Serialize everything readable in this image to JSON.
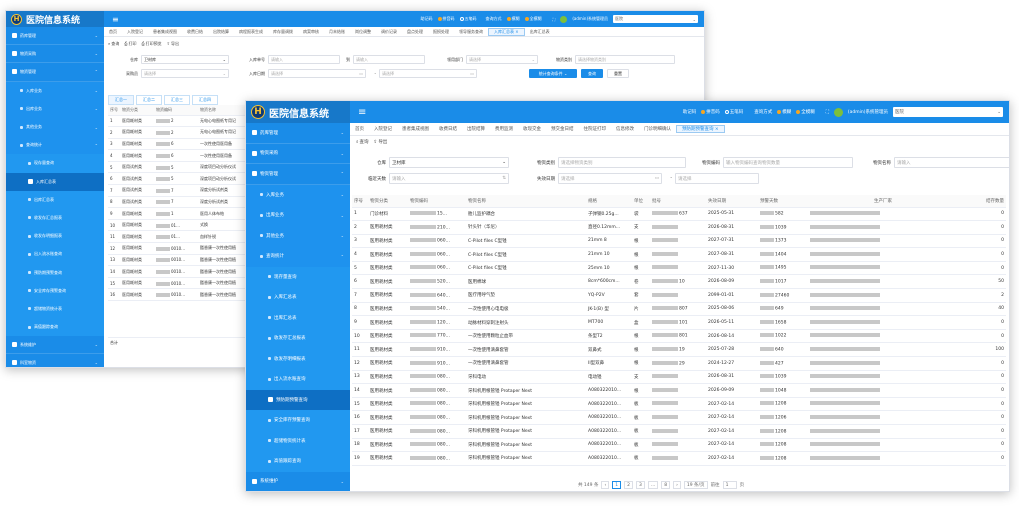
{
  "app_title": "医院信息系统",
  "logo_badge": "H",
  "topbar": {
    "mnemonic_label": "助记码",
    "pinyin": "拼音码",
    "wubi": "五笔码",
    "query_mode_label": "查询方式",
    "fuzzy": "模糊",
    "exact": "全模糊",
    "user": "(admin)系统管理员",
    "hospital_back": "医院",
    "hospital_front": "医院"
  },
  "back": {
    "sidebar": [
      {
        "label": "药库管理",
        "chev": "⌄",
        "kind": "top"
      },
      {
        "label": "物资采购",
        "chev": "⌄",
        "kind": "top"
      },
      {
        "label": "物资管理",
        "chev": "⌃",
        "kind": "top"
      },
      {
        "label": "入库业务",
        "chev": "⌄",
        "kind": "sub"
      },
      {
        "label": "出库业务",
        "chev": "⌄",
        "kind": "sub"
      },
      {
        "label": "其他业务",
        "chev": "⌄",
        "kind": "sub"
      },
      {
        "label": "查询统计",
        "chev": "⌃",
        "kind": "sub"
      },
      {
        "label": "现存量查询",
        "chev": "",
        "kind": "sub2"
      },
      {
        "label": "入库汇总表",
        "chev": "",
        "kind": "act"
      },
      {
        "label": "出库汇总表",
        "chev": "",
        "kind": "sub2"
      },
      {
        "label": "收发存汇总报表",
        "chev": "",
        "kind": "sub2"
      },
      {
        "label": "收发存明细报表",
        "chev": "",
        "kind": "sub2"
      },
      {
        "label": "出入流水账查询",
        "chev": "",
        "kind": "sub2"
      },
      {
        "label": "预防期预警查询",
        "chev": "",
        "kind": "sub2"
      },
      {
        "label": "安全库存预警查询",
        "chev": "",
        "kind": "sub2"
      },
      {
        "label": "超储物资统计表",
        "chev": "",
        "kind": "sub2"
      },
      {
        "label": "高值跟踪查询",
        "chev": "",
        "kind": "sub2"
      },
      {
        "label": "系统维护",
        "chev": "⌄",
        "kind": "top"
      },
      {
        "label": "科室物资",
        "chev": "⌄",
        "kind": "top"
      }
    ],
    "tabs": [
      "首页",
      "入院登记",
      "患者集成视图",
      "收费日结",
      "出院结算",
      "病程报表生成",
      "库存量调拨",
      "病案审核",
      "月末结账",
      "岗位调整",
      "调价记录",
      "盘点处理",
      "报损处理",
      "领导服务查询",
      "入库汇总表 ×",
      "出库汇总表"
    ],
    "toolbar": [
      "查询",
      "打印",
      "打印预览",
      "导出"
    ],
    "form": {
      "warehouse_label": "仓库",
      "warehouse_value": "卫材库",
      "entry_no_label": "入库单号",
      "entry_no_ph": "请输入",
      "to_label": "到",
      "to_ph": "请输入",
      "dept_label": "领用部门",
      "dept_ph": "请选择",
      "category_label": "物资类别",
      "category_ph": "请选择物资类别",
      "buyer_label": "采购员",
      "buyer_ph": "请选择",
      "date_label": "入库日期",
      "date_ph": "请选择",
      "date_end_ph": "请选择",
      "btn_stat": "统计查询条件 ⌄",
      "btn_query": "查询",
      "btn_reset": "重置"
    },
    "subtabs": [
      "汇总一",
      "汇总二",
      "汇总三",
      "汇总四"
    ],
    "columns": [
      "序号",
      "物资分类",
      "物资编码",
      "物资名称"
    ],
    "rows": [
      [
        "1",
        "医用耗材类",
        "2",
        "无电心电图纸专用记"
      ],
      [
        "2",
        "医用耗材类",
        "2",
        "无电心电图纸专用记"
      ],
      [
        "3",
        "医用耗材类",
        "6",
        "一次性使用医用备"
      ],
      [
        "4",
        "医用耗材类",
        "6",
        "一次性使用医用备"
      ],
      [
        "5",
        "医用试剂类",
        "5",
        "深度项目动分析仪试"
      ],
      [
        "6",
        "医用试剂类",
        "5",
        "深度项目动分析仪试"
      ],
      [
        "7",
        "医用试剂类",
        "7",
        "深度分析试剂类"
      ],
      [
        "8",
        "医用试剂类",
        "7",
        "深度分析试剂类"
      ],
      [
        "9",
        "医用耗材类",
        "1",
        "医用人体布帕"
      ],
      [
        "10",
        "医用耗材类",
        "01...",
        "式换"
      ],
      [
        "11",
        "医用耗材类",
        "01...",
        "血样针锐"
      ],
      [
        "12",
        "医用耗材类",
        "0010...",
        "酯香康一次性使用植"
      ],
      [
        "13",
        "医用耗材类",
        "0010...",
        "酯香康一次性使用植"
      ],
      [
        "14",
        "医用耗材类",
        "0010...",
        "酯香康一次性使用植"
      ],
      [
        "15",
        "医用耗材类",
        "0010...",
        "酯香康一次性使用植"
      ],
      [
        "16",
        "医用耗材类",
        "0010...",
        "酯香康一次性使用植"
      ]
    ],
    "total_label": "合计"
  },
  "front": {
    "sidebar": [
      {
        "label": "药库管理",
        "chev": "⌄",
        "kind": "top"
      },
      {
        "label": "物资采购",
        "chev": "⌄",
        "kind": "top"
      },
      {
        "label": "物资管理",
        "chev": "⌃",
        "kind": "top"
      },
      {
        "label": "入库业务",
        "chev": "⌄",
        "kind": "sub"
      },
      {
        "label": "出库业务",
        "chev": "⌄",
        "kind": "sub"
      },
      {
        "label": "其他业务",
        "chev": "⌄",
        "kind": "sub"
      },
      {
        "label": "查询统计",
        "chev": "⌃",
        "kind": "sub"
      },
      {
        "label": "现存量查询",
        "chev": "",
        "kind": "sub2"
      },
      {
        "label": "入库汇总表",
        "chev": "",
        "kind": "sub2"
      },
      {
        "label": "出库汇总表",
        "chev": "",
        "kind": "sub2"
      },
      {
        "label": "收发存汇总报表",
        "chev": "",
        "kind": "sub2"
      },
      {
        "label": "收发存明细报表",
        "chev": "",
        "kind": "sub2"
      },
      {
        "label": "出入流水账查询",
        "chev": "",
        "kind": "sub2"
      },
      {
        "label": "预防期预警查询",
        "chev": "",
        "kind": "act"
      },
      {
        "label": "安全库存预警查询",
        "chev": "",
        "kind": "sub2"
      },
      {
        "label": "超储物资统计表",
        "chev": "",
        "kind": "sub2"
      },
      {
        "label": "高值跟踪查询",
        "chev": "",
        "kind": "sub2"
      },
      {
        "label": "系统维护",
        "chev": "⌄",
        "kind": "top"
      }
    ],
    "tabs": [
      "首页",
      "入院登记",
      "患者集成视图",
      "收费日结",
      "出院结算",
      "费用监测",
      "收现交金",
      "预交金日结",
      "住院证打印",
      "信息修改",
      "门诊明细确认",
      "预防期预警查询 ×"
    ],
    "toolbar": [
      "查询",
      "导出"
    ],
    "form": {
      "warehouse_label": "仓库",
      "warehouse_value": "卫材库",
      "cat_label": "物资类别",
      "cat_ph": "请选择物资类别",
      "code_label": "物资编码",
      "code_ph": "输入物资编码查询物资数量",
      "name_label": "物资名称",
      "name_ph": "请输入",
      "days_label": "临近天数",
      "days_ph": "请输入",
      "expire_label": "失效日期",
      "expire_ph": "请选择",
      "expire_end_ph": "请选择"
    },
    "columns": [
      "序号",
      "物资分类",
      "物资编码",
      "物资名称",
      "规格",
      "单位",
      "批号",
      "失效日期",
      "预警天数",
      "生产厂家",
      "结存数量"
    ],
    "rows": [
      [
        "1",
        "门诊材料",
        "15...",
        "胎儿监护耦合",
        "子弹钢0.25g...",
        "袋",
        "637",
        "2025-05-31",
        "582",
        "",
        "0"
      ],
      [
        "2",
        "医用耗材类",
        "210...",
        "针头针（华尼）",
        "直径0.12mm...",
        "支",
        "",
        "2026-08-31",
        "1039",
        "",
        "0"
      ],
      [
        "3",
        "医用耗材类",
        "060...",
        "C-Pilot files C型锉",
        "21mm 8",
        "根",
        "",
        "2027-07-31",
        "1373",
        "",
        "0"
      ],
      [
        "4",
        "医用耗材类",
        "060...",
        "C-Pilot files C型锉",
        "21mm 10",
        "根",
        "",
        "2027-08-31",
        "1404",
        "",
        "0"
      ],
      [
        "5",
        "医用耗材类",
        "060...",
        "C-Pilot files C型锉",
        "25mm 10",
        "根",
        "",
        "2027-11-30",
        "1495",
        "",
        "0"
      ],
      [
        "6",
        "医用耗材类",
        "520...",
        "医用棉球",
        "8cm*600cm...",
        "卷",
        "10",
        "2026-08-09",
        "1017",
        "",
        "50"
      ],
      [
        "7",
        "医用耗材类",
        "640...",
        "医疗用呼气垫",
        "YQ-P2V",
        "套",
        "",
        "2099-01-01",
        "27460",
        "",
        "2"
      ],
      [
        "8",
        "医用耗材类",
        "540...",
        "一次性使用心电电极",
        "JK-1(B) 型",
        "片",
        "807",
        "2025-08-06",
        "649",
        "",
        "40"
      ],
      [
        "9",
        "医用耗材类",
        "120...",
        "动脉材料穿刺注射头",
        "MT700",
        "盒",
        "101",
        "2026-05-11",
        "1658",
        "",
        "0"
      ],
      [
        "10",
        "医用耗材类",
        "770...",
        "一次性使用颗粒止血带",
        "条型T2",
        "根",
        "801",
        "2026-08-14",
        "1022",
        "",
        "0"
      ],
      [
        "11",
        "医用耗材类",
        "910...",
        "一次性使用滴鼻套管",
        "双鼻式",
        "根",
        "19",
        "2025-07-28",
        "640",
        "",
        "100"
      ],
      [
        "12",
        "医用耗材类",
        "910...",
        "一次性使用滴鼻套管",
        "II型双鼻",
        "根",
        "29",
        "2024-12-27",
        "427",
        "",
        "0"
      ],
      [
        "13",
        "医用耗材类",
        "080...",
        "牙科电动",
        "电动锉",
        "支",
        "",
        "2026-08-31",
        "1039",
        "",
        "0"
      ],
      [
        "14",
        "医用耗材类",
        "080...",
        "牙科机用根管锉 Protaper Next",
        "A080322010...",
        "根",
        "",
        "2026-09-09",
        "1048",
        "",
        "0"
      ],
      [
        "15",
        "医用耗材类",
        "080...",
        "牙科机用根管锉 Protaper Next",
        "A080322010...",
        "板",
        "",
        "2027-02-14",
        "1208",
        "",
        "0"
      ],
      [
        "16",
        "医用耗材类",
        "080...",
        "牙科机用根管锉 Protaper Next",
        "A080322010...",
        "板",
        "",
        "2027-02-14",
        "1206",
        "",
        "0"
      ],
      [
        "17",
        "医用耗材类",
        "080...",
        "牙科机用根管锉 Protaper Next",
        "A080322010...",
        "板",
        "",
        "2027-02-14",
        "1208",
        "",
        "0"
      ],
      [
        "18",
        "医用耗材类",
        "080...",
        "牙科机用根管锉 Protaper Next",
        "A080322010...",
        "板",
        "",
        "2027-02-14",
        "1208",
        "",
        "0"
      ],
      [
        "19",
        "医用耗材类",
        "080...",
        "牙科机用根管锉 Protaper Next",
        "A080322010...",
        "板",
        "",
        "2027-02-14",
        "1208",
        "",
        "0"
      ]
    ],
    "pager": {
      "total": "共 149 条",
      "pages": [
        "1",
        "2",
        "3",
        "...",
        "8"
      ],
      "size": "19 条/页",
      "goto_label": "前往",
      "goto_value": "1",
      "page_unit": "页"
    }
  }
}
